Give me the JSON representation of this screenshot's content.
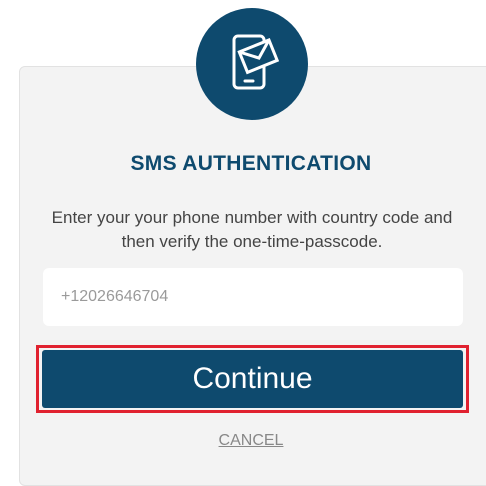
{
  "header": {
    "icon": "sms-phone-envelope-icon"
  },
  "title": "SMS AUTHENTICATION",
  "description": "Enter your your phone number with country code and then verify the one-time-passcode.",
  "phone_input": {
    "placeholder": "+12026646704",
    "value": ""
  },
  "buttons": {
    "continue_label": "Continue",
    "cancel_label": "CANCEL"
  },
  "colors": {
    "brand": "#0e4a6e",
    "highlight": "#e0212f",
    "card_background": "#f3f3f3"
  }
}
